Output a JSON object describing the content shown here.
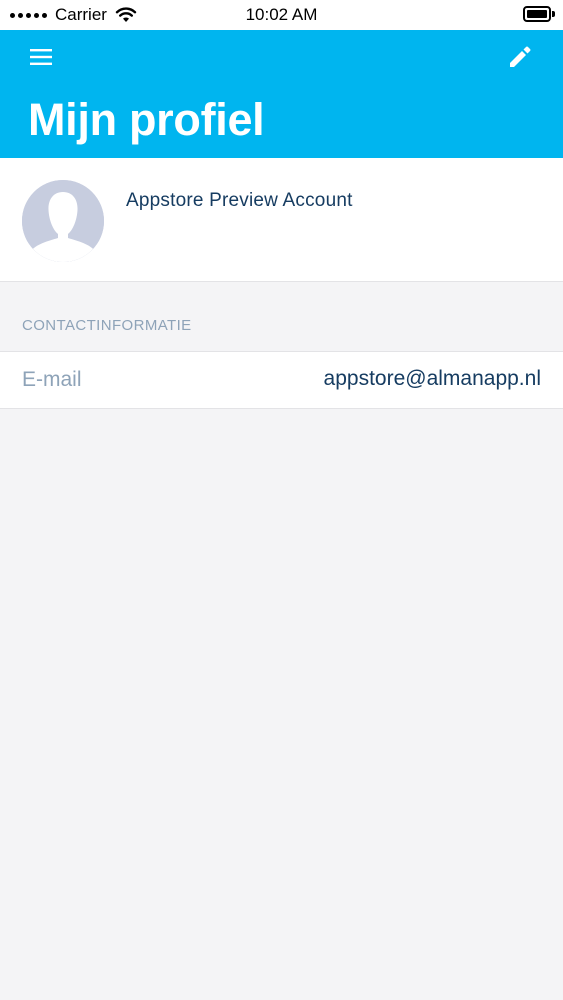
{
  "status_bar": {
    "carrier": "Carrier",
    "time": "10:02 AM",
    "wifi_icon": "wifi-icon",
    "battery_icon": "battery-icon"
  },
  "header": {
    "background_color": "#00b5ef",
    "menu_icon": "hamburger-menu-icon",
    "edit_icon": "pencil-icon",
    "title": "Mijn profiel"
  },
  "profile": {
    "name": "Appstore Preview Account",
    "avatar_icon": "default-avatar-silhouette-icon"
  },
  "contact": {
    "section_title": "CONTACTINFORMATIE",
    "rows": [
      {
        "label": "E-mail",
        "value": "appstore@almanapp.nl"
      }
    ]
  },
  "colors": {
    "primary_text": "#163c61",
    "secondary_text": "#8ea3b8",
    "background": "#f4f4f6"
  }
}
